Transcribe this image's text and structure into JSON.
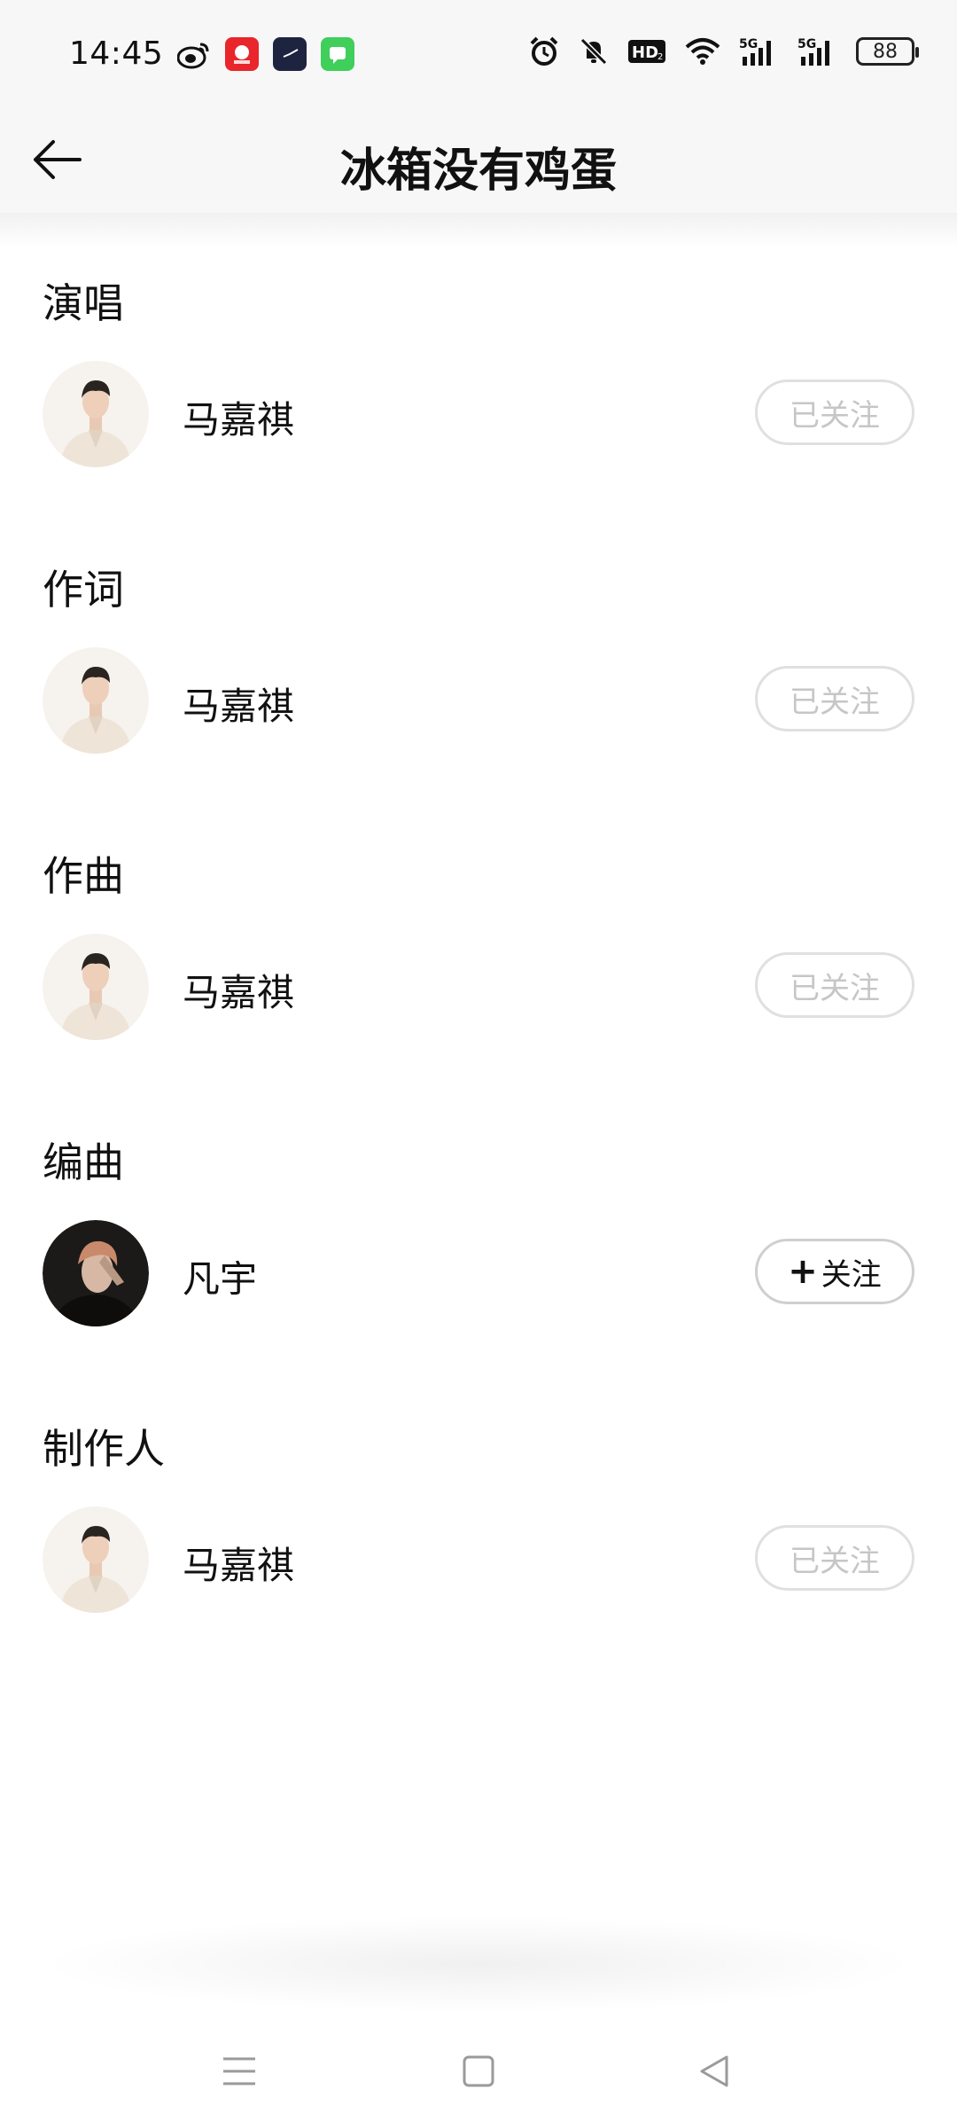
{
  "status_bar": {
    "time": "14:45",
    "notification_icons": [
      "weibo-icon",
      "news-app-icon",
      "clock-app-icon",
      "messages-icon"
    ],
    "system_icons": [
      "alarm-icon",
      "mute-icon",
      "hd-icon",
      "wifi-icon",
      "signal-5g-icon",
      "signal-5g-icon"
    ],
    "battery": "88"
  },
  "header": {
    "title": "冰箱没有鸡蛋",
    "back_icon": "back-arrow-icon"
  },
  "sections": [
    {
      "title": "演唱",
      "person": {
        "name": "马嘉祺",
        "follow_label": "已关注",
        "followed": true
      }
    },
    {
      "title": "作词",
      "person": {
        "name": "马嘉祺",
        "follow_label": "已关注",
        "followed": true
      }
    },
    {
      "title": "作曲",
      "person": {
        "name": "马嘉祺",
        "follow_label": "已关注",
        "followed": true
      }
    },
    {
      "title": "编曲",
      "person": {
        "name": "凡宇",
        "follow_label": "关注",
        "followed": false
      }
    },
    {
      "title": "制作人",
      "person": {
        "name": "马嘉祺",
        "follow_label": "已关注",
        "followed": true
      }
    }
  ],
  "colors": {
    "text_primary": "#111111",
    "followed_text": "#c6c6c6",
    "followed_border": "#e0e0e0",
    "status_bg": "#f7f7f7"
  },
  "nav_bar": {
    "icons": [
      "menu-icon",
      "home-square-icon",
      "back-triangle-icon"
    ]
  }
}
